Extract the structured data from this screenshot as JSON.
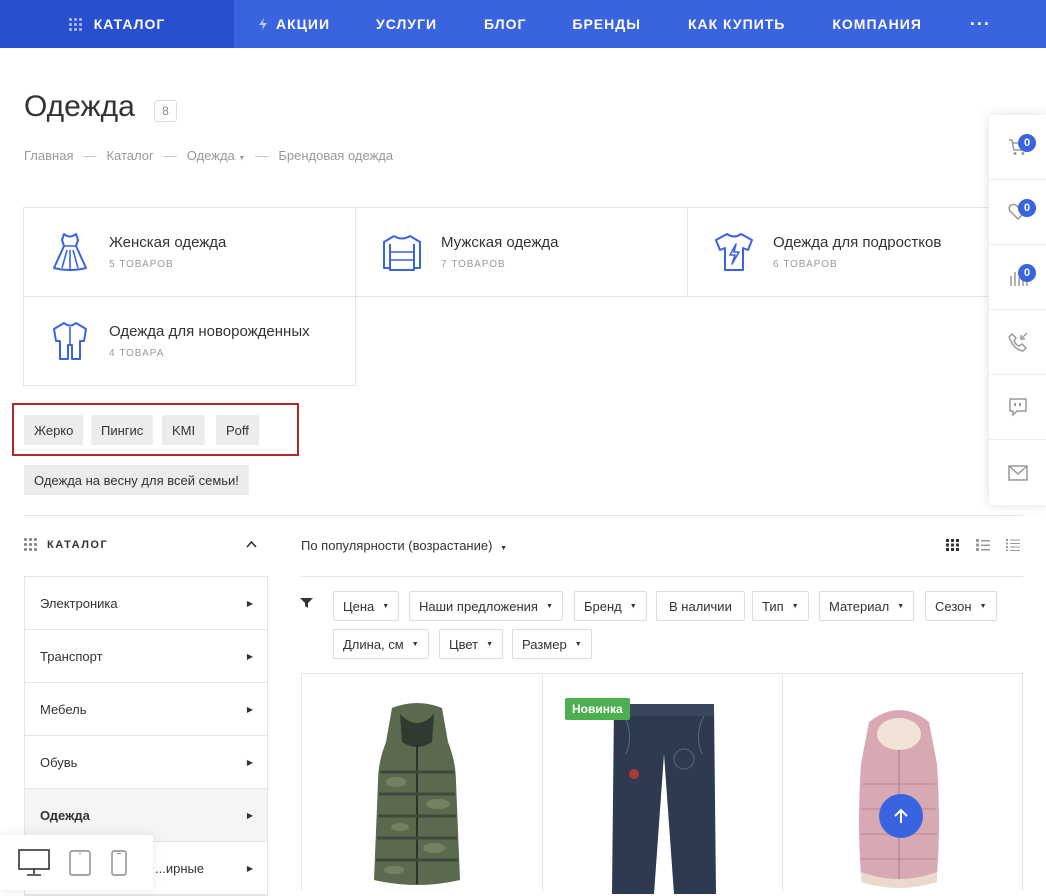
{
  "nav": {
    "catalog": "КАТАЛОГ",
    "items": [
      "АКЦИИ",
      "УСЛУГИ",
      "БЛОГ",
      "БРЕНДЫ",
      "КАК КУПИТЬ",
      "КОМПАНИЯ"
    ],
    "more": "···"
  },
  "page": {
    "title": "Одежда",
    "count": "8"
  },
  "breadcrumbs": [
    "Главная",
    "Каталог",
    "Одежда",
    "Брендовая одежда"
  ],
  "breadcrumb_sep": "—",
  "categories": [
    {
      "name": "Женская одежда",
      "count": "5 ТОВАРОВ",
      "icon": "dress-icon"
    },
    {
      "name": "Мужская одежда",
      "count": "7 ТОВАРОВ",
      "icon": "sweater-icon"
    },
    {
      "name": "Одежда для подростков",
      "count": "6 ТОВАРОВ",
      "icon": "tshirt-icon"
    },
    {
      "name": "Одежда для новорожденных",
      "count": "4 ТОВАРА",
      "icon": "onesie-icon"
    }
  ],
  "brand_tags": [
    "Жерко",
    "Пингис",
    "KMI",
    "Poff"
  ],
  "promo_tag": "Одежда на весну для всей семьи!",
  "sidebar": {
    "title": "КАТАЛОГ",
    "items": [
      "Электроника",
      "Транспорт",
      "Мебель",
      "Обувь",
      "Одежда",
      "...ирные"
    ]
  },
  "sort": {
    "label": "По популярности (возрастание)"
  },
  "filters": [
    "Цена",
    "Наши предложения",
    "Бренд",
    "В наличии",
    "Тип",
    "Материал",
    "Сезон",
    "Длина, см",
    "Цвет",
    "Размер"
  ],
  "products": [
    {
      "icon": "vest-image"
    },
    {
      "icon": "jeans-image",
      "badge": "Новинка"
    },
    {
      "icon": "sleeping-bag-image"
    }
  ],
  "right_panel": {
    "cart_count": "0",
    "favorites_count": "0",
    "compare_count": "0"
  },
  "colors": {
    "primary": "#3a63e0",
    "primary_dark": "#2a4ed0",
    "new_badge": "#4caf50",
    "highlight_border": "#b52525"
  }
}
